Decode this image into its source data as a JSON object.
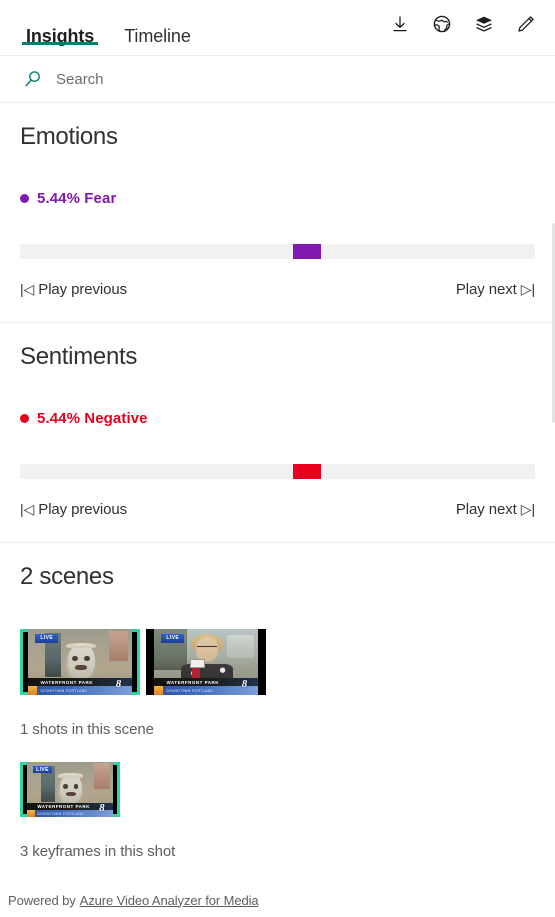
{
  "header": {
    "tabs": [
      {
        "label": "Insights",
        "active": true
      },
      {
        "label": "Timeline",
        "active": false
      }
    ],
    "actions": [
      {
        "name": "download-icon",
        "title": "Download"
      },
      {
        "name": "globe-icon",
        "title": "Translate"
      },
      {
        "name": "layers-icon",
        "title": "View"
      },
      {
        "name": "edit-icon",
        "title": "Edit"
      }
    ]
  },
  "search": {
    "placeholder": "Search",
    "value": "",
    "icon": "search-icon"
  },
  "emotions": {
    "title": "Emotions",
    "legend_label": "5.44% Fear",
    "legend_color": "#8019b0",
    "percent": 5.44,
    "emotion": "Fear",
    "marker_color": "#8019b0",
    "marker_position_pct": 53,
    "track_color": "#f1f1f1",
    "play_previous": "Play previous",
    "play_next": "Play next",
    "prev_glyph": "|◁",
    "next_glyph": "▷|"
  },
  "sentiments": {
    "title": "Sentiments",
    "legend_label": "5.44% Negative",
    "legend_color": "#e8001c",
    "percent": 5.44,
    "sentiment": "Negative",
    "marker_color": "#e8001c",
    "marker_position_pct": 53,
    "track_color": "#f1f1f1",
    "play_previous": "Play previous",
    "play_next": "Play next",
    "prev_glyph": "|◁",
    "next_glyph": "▷|"
  },
  "scenes": {
    "title": "2 scenes",
    "count": 2,
    "selection_color": "#2fd6a3",
    "thumbnails": [
      {
        "name": "scene-thumbnail-1",
        "selected": true,
        "overlay_live": "LIVE",
        "overlay_location": "WATERFRONT PARK",
        "overlay_subtitle": "DOWNTOWN PORTLAND",
        "overlay_channel": "8"
      },
      {
        "name": "scene-thumbnail-2",
        "selected": false,
        "overlay_live": "LIVE",
        "overlay_location": "WATERFRONT PARK",
        "overlay_subtitle": "DOWNTOWN PORTLAND",
        "overlay_channel": "8"
      }
    ],
    "shots_label": "1 shots in this scene",
    "shot_thumbnail": {
      "name": "shot-thumbnail-1",
      "selected": true,
      "overlay_live": "LIVE",
      "overlay_location": "WATERFRONT PARK",
      "overlay_subtitle": "DOWNTOWN PORTLAND",
      "overlay_channel": "8"
    },
    "keyframes_label": "3 keyframes in this shot"
  },
  "footer": {
    "powered_by": "Powered by",
    "link_label": "Azure Video Analyzer for Media"
  },
  "theme": {
    "accent_teal": "#107c71",
    "divider": "#ededed",
    "text_primary": "#323130",
    "text_secondary": "#605e5c"
  }
}
